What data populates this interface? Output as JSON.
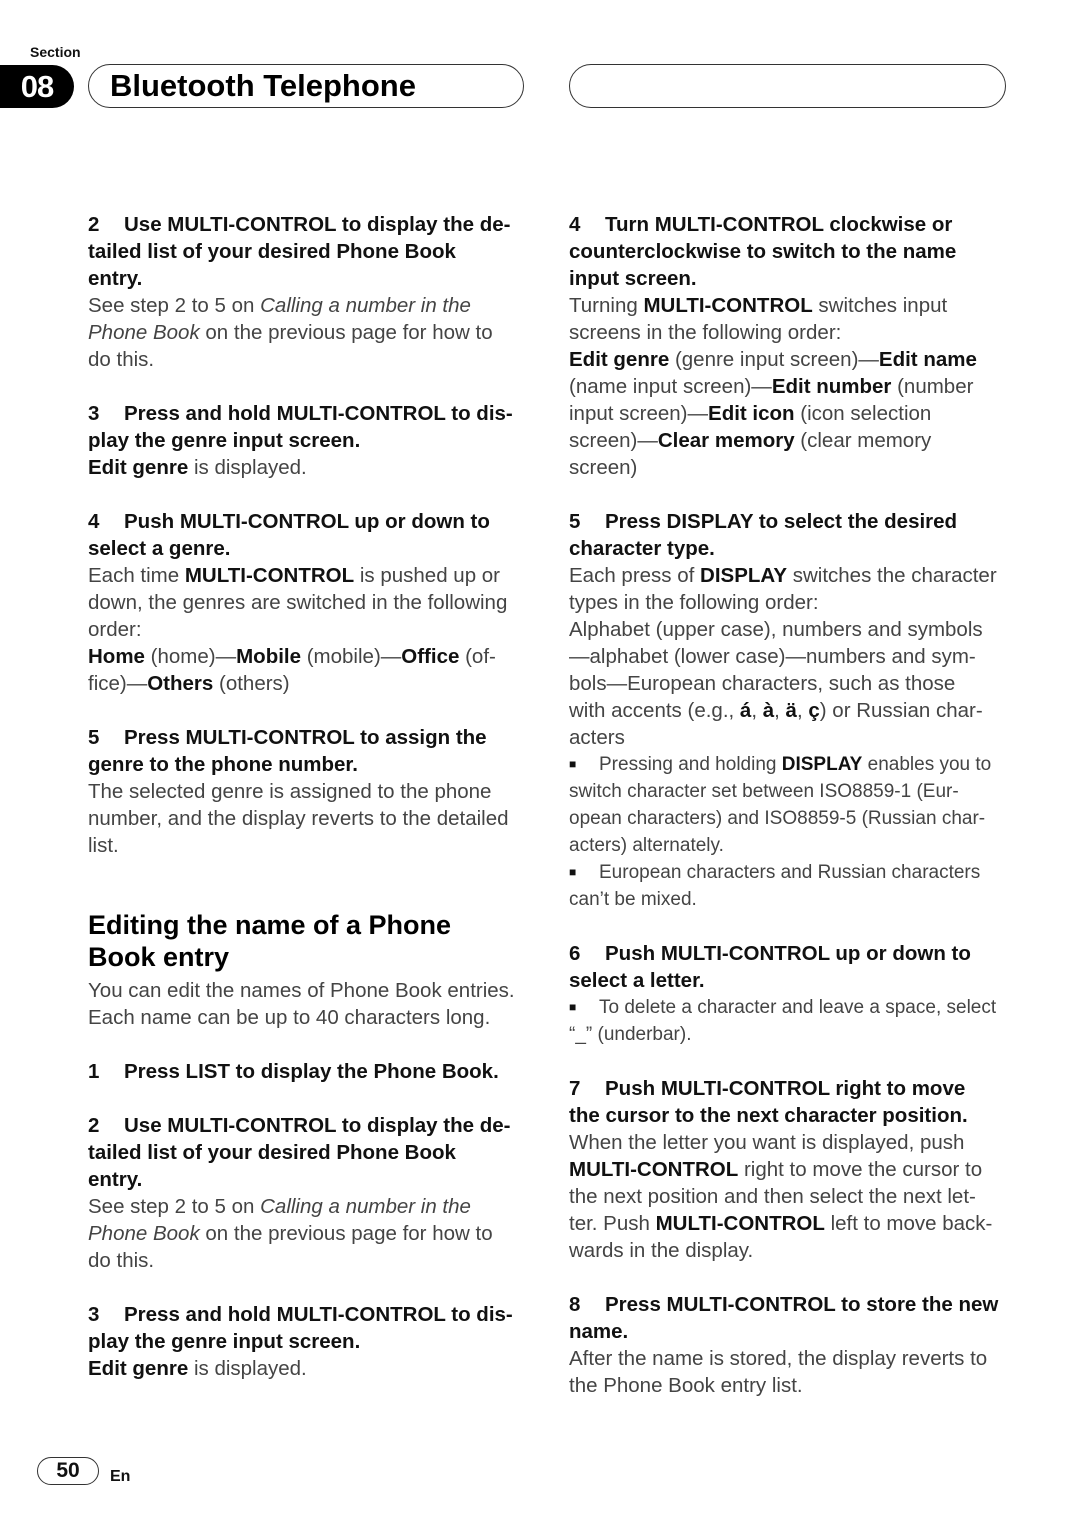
{
  "header": {
    "section_label": "Section",
    "section_number": "08",
    "title": "Bluetooth Telephone"
  },
  "left_column": {
    "step2a": {
      "number": "2",
      "heading": [
        "Use MULTI-CONTROL to display the de-",
        "tailed list of your desired Phone Book",
        "entry."
      ],
      "body": [
        {
          "pre": "See step 2 to 5 on ",
          "em": "Calling a number in the",
          "post": ""
        },
        {
          "pre": "",
          "em": "Phone Book",
          "post": " on the previous page for how to"
        },
        {
          "pre": "do this.",
          "em": "",
          "post": ""
        }
      ]
    },
    "step3a": {
      "number": "3",
      "heading": [
        "Press and hold MULTI-CONTROL to dis-",
        "play the genre input screen."
      ],
      "body_bold": "Edit genre",
      "body_rest": " is displayed."
    },
    "step4a": {
      "number": "4",
      "heading": [
        "Push MULTI-CONTROL up or down to",
        "select a genre."
      ],
      "body_line1_pre": "Each time ",
      "body_line1_bold": "MULTI-CONTROL",
      "body_line1_post": " is pushed up or",
      "body_line2": "down, the genres are switched in the following",
      "body_line3": "order:",
      "genres_line1": [
        {
          "bold": "Home",
          "text": " (home)—"
        },
        {
          "bold": "Mobile",
          "text": " (mobile)—"
        },
        {
          "bold": "Office",
          "text": " (of-"
        }
      ],
      "genres_line2": [
        {
          "bold": "",
          "text": "fice)—"
        },
        {
          "bold": "Others",
          "text": " (others)"
        }
      ]
    },
    "step5a": {
      "number": "5",
      "heading": [
        "Press MULTI-CONTROL to assign the",
        "genre to the phone number."
      ],
      "body": [
        "The selected genre is assigned to the phone",
        "number, and the display reverts to the detailed",
        "list."
      ]
    },
    "section_heading": [
      "Editing the name of a Phone",
      "Book entry"
    ],
    "intro": [
      "You can edit the names of Phone Book entries.",
      "Each name can be up to 40 characters long."
    ],
    "step1b": {
      "number": "1",
      "heading": [
        "Press LIST to display the Phone Book."
      ]
    },
    "step2b": {
      "number": "2",
      "heading": [
        "Use MULTI-CONTROL to display the de-",
        "tailed list of your desired Phone Book",
        "entry."
      ],
      "body": [
        {
          "pre": "See step 2 to 5 on ",
          "em": "Calling a number in the",
          "post": ""
        },
        {
          "pre": "",
          "em": "Phone Book",
          "post": " on the previous page for how to"
        },
        {
          "pre": "do this.",
          "em": "",
          "post": ""
        }
      ]
    },
    "step3b": {
      "number": "3",
      "heading": [
        "Press and hold MULTI-CONTROL to dis-",
        "play the genre input screen."
      ],
      "body_bold": "Edit genre",
      "body_rest": " is displayed."
    }
  },
  "right_column": {
    "step4": {
      "number": "4",
      "heading": [
        "Turn MULTI-CONTROL clockwise or",
        "counterclockwise to switch to the name",
        "input screen."
      ],
      "l1": {
        "pre": "Turning ",
        "bold": "MULTI-CONTROL",
        "post": " switches input"
      },
      "l2": "screens in the following order:",
      "l3": [
        {
          "bold": "Edit genre",
          "text": " (genre input screen)—"
        },
        {
          "bold": "Edit name",
          "text": ""
        }
      ],
      "l4": [
        {
          "bold": "",
          "text": "(name input screen)—"
        },
        {
          "bold": "Edit number",
          "text": " (number"
        }
      ],
      "l5": [
        {
          "bold": "",
          "text": "input screen)—"
        },
        {
          "bold": "Edit icon",
          "text": " (icon selection"
        }
      ],
      "l6": [
        {
          "bold": "",
          "text": "screen)—"
        },
        {
          "bold": "Clear memory",
          "text": " (clear memory"
        }
      ],
      "l7": "screen)"
    },
    "step5": {
      "number": "5",
      "heading": [
        "Press DISPLAY to select the desired",
        "character type."
      ],
      "l1": {
        "pre": "Each press of ",
        "bold": "DISPLAY",
        "post": " switches the character"
      },
      "l2": "types in the following order:",
      "l3": "Alphabet (upper case), numbers and symbols",
      "l4": "—alphabet (lower case)—numbers and sym-",
      "l5": "bols—European characters, such as those",
      "l6_pre": "with accents (e.g., ",
      "accents": [
        "á",
        "à",
        "ä",
        "ç"
      ],
      "l6_post": ") or Russian char-",
      "l7": "acters",
      "note1": {
        "l1_pre": "Pressing and holding ",
        "l1_bold": "DISPLAY",
        "l1_post": " enables you to",
        "l2": "switch character set between ISO8859-1 (Eur-",
        "l3": "opean characters) and ISO8859-5 (Russian char-",
        "l4": "acters) alternately."
      },
      "note2": {
        "l1": "European characters and Russian characters",
        "l2": "can’t be mixed."
      }
    },
    "step6": {
      "number": "6",
      "heading": [
        "Push MULTI-CONTROL up or down to",
        "select a letter."
      ],
      "note": {
        "l1": "To delete a character and leave a space, select",
        "l2": "“_” (underbar)."
      }
    },
    "step7": {
      "number": "7",
      "heading": [
        "Push MULTI-CONTROL right to move",
        "the cursor to the next character position."
      ],
      "l1": "When the letter you want is displayed, push",
      "l2_bold": "MULTI-CONTROL",
      "l2_post": " right to move the cursor to",
      "l3": "the next position and then select the next let-",
      "l4_pre": "ter. Push ",
      "l4_bold": "MULTI-CONTROL",
      "l4_post": " left to move back-",
      "l5": "wards in the display."
    },
    "step8": {
      "number": "8",
      "heading": [
        "Press MULTI-CONTROL to store the new",
        "name."
      ],
      "body": [
        "After the name is stored, the display reverts to",
        "the Phone Book entry list."
      ]
    }
  },
  "footer": {
    "page_number": "50",
    "language": "En"
  },
  "icons": {
    "bullet": "■"
  }
}
